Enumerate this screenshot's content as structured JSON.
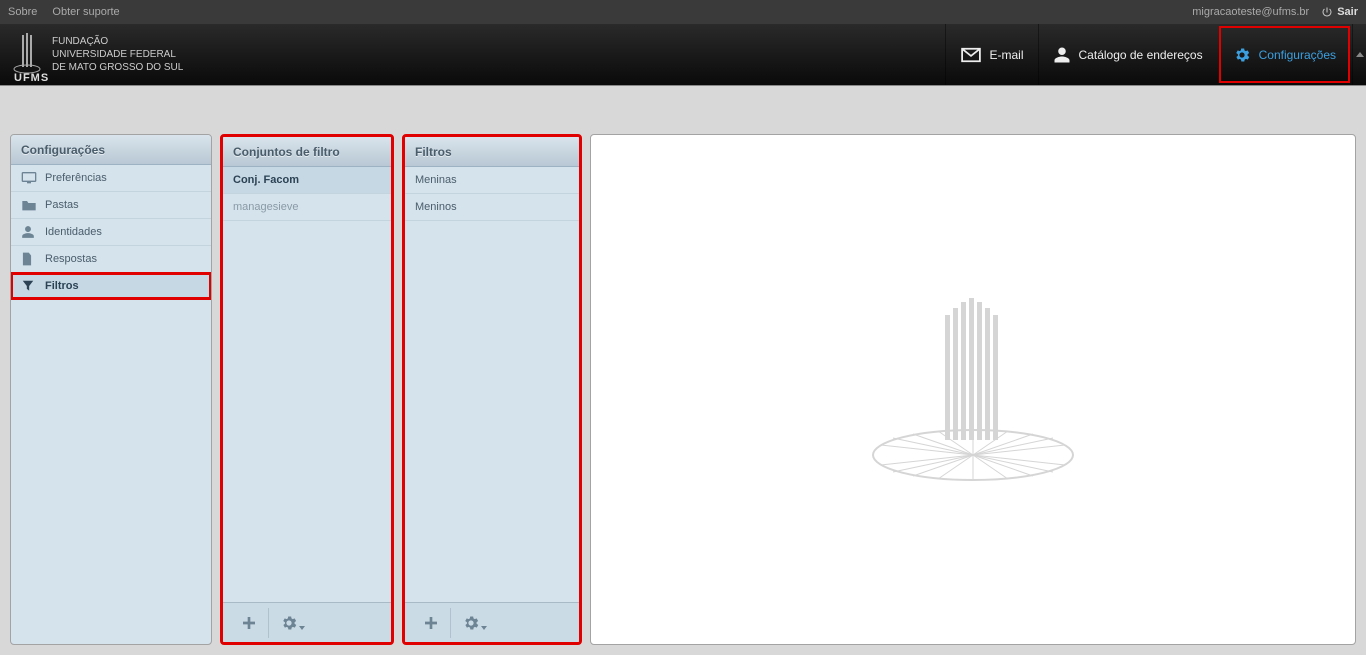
{
  "topbar": {
    "about": "Sobre",
    "support": "Obter suporte",
    "user_email": "migracaoteste@ufms.br",
    "logout": "Sair"
  },
  "header": {
    "org_line1": "FUNDAÇÃO",
    "org_line2": "UNIVERSIDADE FEDERAL",
    "org_line3": "DE MATO GROSSO DO SUL",
    "ufms": "UFMS",
    "nav": {
      "email": "E-mail",
      "contacts": "Catálogo de endereços",
      "settings": "Configurações"
    }
  },
  "panels": {
    "settings": {
      "title": "Configurações",
      "items": [
        {
          "label": "Preferências"
        },
        {
          "label": "Pastas"
        },
        {
          "label": "Identidades"
        },
        {
          "label": "Respostas"
        },
        {
          "label": "Filtros"
        }
      ]
    },
    "filtersets": {
      "title": "Conjuntos de filtro",
      "items": [
        {
          "label": "Conj. Facom"
        },
        {
          "label": "managesieve"
        }
      ]
    },
    "filters": {
      "title": "Filtros",
      "items": [
        {
          "label": "Meninas"
        },
        {
          "label": "Meninos"
        }
      ]
    }
  }
}
